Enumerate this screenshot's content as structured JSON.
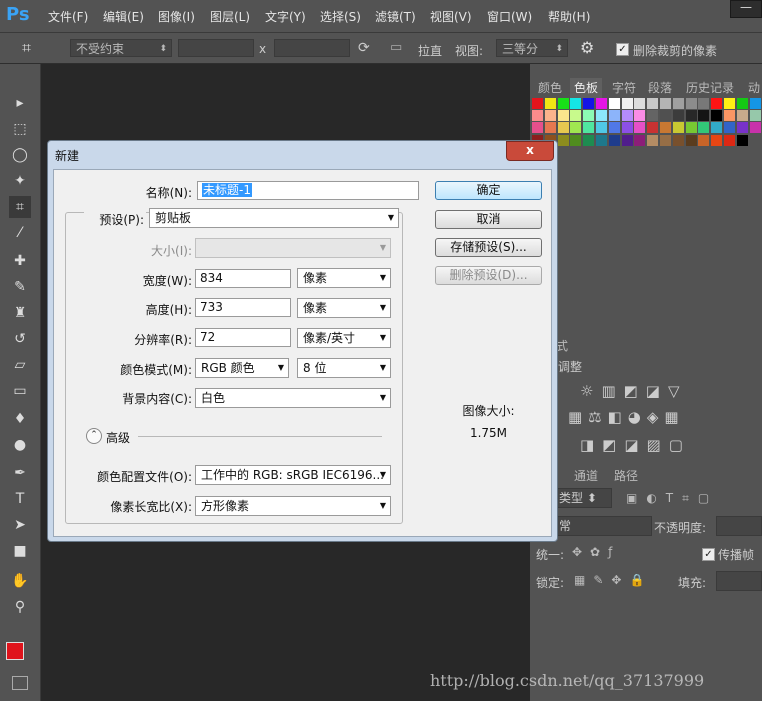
{
  "app": {
    "logo": "Ps"
  },
  "menu": [
    "文件(F)",
    "编辑(E)",
    "图像(I)",
    "图层(L)",
    "文字(Y)",
    "选择(S)",
    "滤镜(T)",
    "视图(V)",
    "窗口(W)",
    "帮助(H)"
  ],
  "options_bar": {
    "constraint": "不受约束",
    "x_sep": "x",
    "straighten": "拉直",
    "view_label": "视图:",
    "view_value": "三等分",
    "delete_cropped": "删除裁剪的像素",
    "delete_cropped_checked": true
  },
  "tools": [
    "move-icon",
    "marquee-icon",
    "lasso-icon",
    "magic-wand-icon",
    "crop-icon",
    "eyedropper-icon",
    "healing-icon",
    "brush-icon",
    "stamp-icon",
    "history-brush-icon",
    "eraser-icon",
    "gradient-icon",
    "blur-icon",
    "dodge-icon",
    "pen-icon",
    "type-icon",
    "path-select-icon",
    "shape-icon",
    "hand-icon",
    "zoom-icon"
  ],
  "colors": {
    "foreground": "#e0141c",
    "background": "#000000",
    "accent_blue": "#3c7fb1"
  },
  "right_panel": {
    "tabs_top": [
      "颜色",
      "色板",
      "字符",
      "段落",
      "历史记录",
      "动"
    ],
    "active_tab": "色板",
    "styles_tab": "样式",
    "adjust_title": "调整",
    "layers_tabs": [
      "通道",
      "路径"
    ],
    "kind_label": "类型",
    "blend_mode": "常",
    "opacity_label": "不透明度:",
    "unify_label": "统一:",
    "propagate_label": "传播帧",
    "lock_label": "锁定:",
    "fill_label": "填充:"
  },
  "dialog": {
    "title": "新建",
    "close_label": "x",
    "name_label": "名称(N):",
    "name_value": "未标题-1",
    "preset_label": "预设(P):",
    "preset_value": "剪贴板",
    "size_label": "大小(I):",
    "width_label": "宽度(W):",
    "width_value": "834",
    "width_unit": "像素",
    "height_label": "高度(H):",
    "height_value": "733",
    "height_unit": "像素",
    "resolution_label": "分辨率(R):",
    "resolution_value": "72",
    "resolution_unit": "像素/英寸",
    "color_mode_label": "颜色模式(M):",
    "color_mode_value": "RGB 颜色",
    "bit_depth_value": "8 位",
    "background_label": "背景内容(C):",
    "background_value": "白色",
    "advanced_label": "高级",
    "profile_label": "颜色配置文件(O):",
    "profile_value": "工作中的 RGB: sRGB IEC6196...",
    "aspect_label": "像素长宽比(X):",
    "aspect_value": "方形像素",
    "ok_label": "确定",
    "cancel_label": "取消",
    "save_preset_label": "存储预设(S)...",
    "delete_preset_label": "删除预设(D)...",
    "image_size_label": "图像大小:",
    "image_size_value": "1.75M"
  },
  "watermark": "http://blog.csdn.net/qq_37137999"
}
